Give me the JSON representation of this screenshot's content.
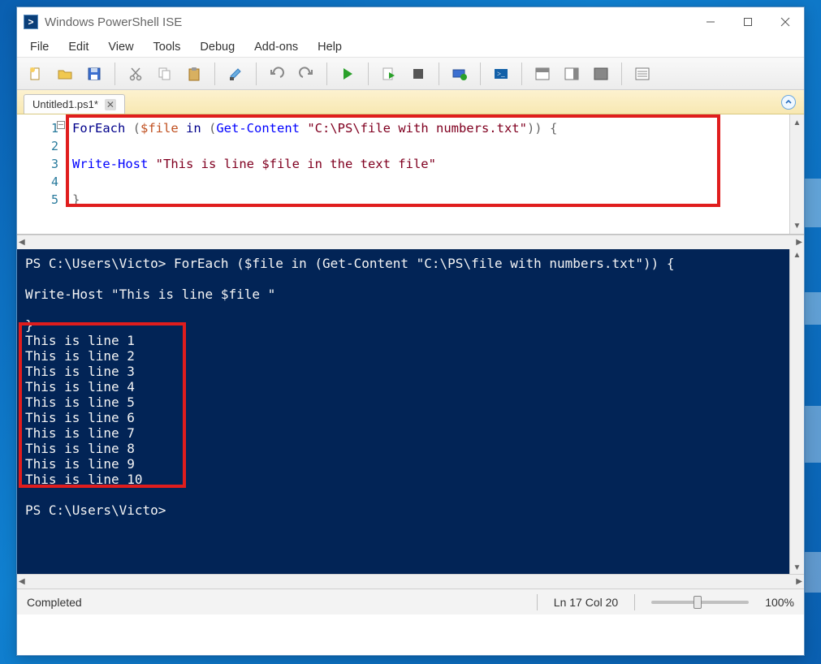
{
  "window": {
    "title": "Windows PowerShell ISE"
  },
  "menus": [
    "File",
    "Edit",
    "View",
    "Tools",
    "Debug",
    "Add-ons",
    "Help"
  ],
  "toolbar": {
    "buttons": [
      "new-file",
      "open-file",
      "save-file",
      "cut",
      "copy",
      "paste",
      "clear",
      "undo",
      "redo",
      "run-script",
      "run-selection",
      "stop",
      "remote",
      "powershell",
      "show-script-pane",
      "show-split",
      "show-commands"
    ]
  },
  "tab": {
    "name": "Untitled1.ps1*"
  },
  "editor": {
    "line_numbers": [
      "1",
      "2",
      "3",
      "4",
      "5"
    ],
    "tokens": {
      "l1_kw1": "ForEach ",
      "l1_p1": "(",
      "l1_var": "$file",
      "l1_kw2": " in ",
      "l1_p2": "(",
      "l1_cmd": "Get-Content",
      "l1_sp": " ",
      "l1_str": "\"C:\\PS\\file with numbers.txt\"",
      "l1_end": ")) {",
      "l3_cmd": "Write-Host",
      "l3_sp": " ",
      "l3_str": "\"This is line $file in the text file\"",
      "l5_end": "}"
    }
  },
  "console": {
    "cmd_line1": "PS C:\\Users\\Victo> ForEach ($file in (Get-Content \"C:\\PS\\file with numbers.txt\")) {",
    "cmd_line2": "",
    "cmd_line3": "Write-Host \"This is line $file \"",
    "cmd_line4": "",
    "cmd_line5": "}",
    "output": [
      "This is line 1",
      "This is line 2",
      "This is line 3",
      "This is line 4",
      "This is line 5",
      "This is line 6",
      "This is line 7",
      "This is line 8",
      "This is line 9",
      "This is line 10"
    ],
    "prompt_after": "PS C:\\Users\\Victo> "
  },
  "status": {
    "left": "Completed",
    "position": "Ln 17  Col 20",
    "zoom": "100%"
  }
}
